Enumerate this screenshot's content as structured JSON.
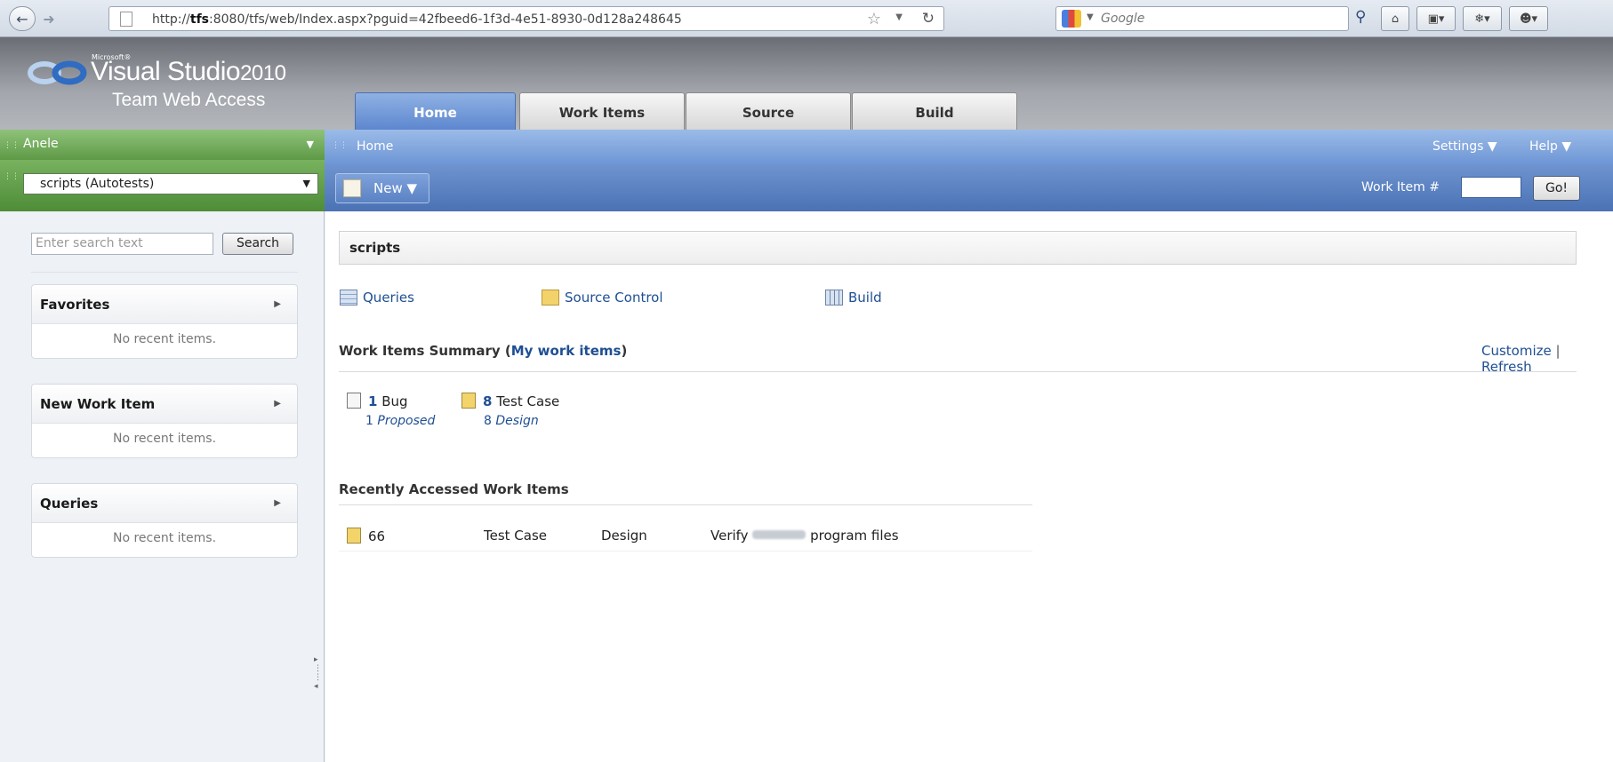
{
  "browser": {
    "url_prefix": "http://",
    "url_host": "tfs",
    "url_rest": ":8080/tfs/web/Index.aspx?pguid=42fbeed6-1f3d-4e51-8930-0d128a248645",
    "search_engine": "Google"
  },
  "logo": {
    "microsoft": "Microsoft®",
    "product": "Visual Studio",
    "year": "2010",
    "subtitle": "Team Web Access"
  },
  "tabs": [
    {
      "label": "Home"
    },
    {
      "label": "Work Items"
    },
    {
      "label": "Source"
    },
    {
      "label": "Build"
    }
  ],
  "left": {
    "user": "Anele",
    "project": "scripts (Autotests)",
    "search_placeholder": "Enter search text",
    "search_button": "Search",
    "panes": [
      {
        "title": "Favorites",
        "empty": "No recent items."
      },
      {
        "title": "New Work Item",
        "empty": "No recent items."
      },
      {
        "title": "Queries",
        "empty": "No recent items."
      }
    ]
  },
  "nav": {
    "breadcrumb": "Home",
    "settings": "Settings",
    "help": "Help",
    "new_button": "New",
    "work_item_label": "Work Item #",
    "go_button": "Go!"
  },
  "main": {
    "project_title": "scripts",
    "quick_links": [
      "Queries",
      "Source Control",
      "Build"
    ],
    "summary_title": "Work Items Summary (",
    "summary_link": "My work items",
    "summary_close": ")",
    "customize": "Customize",
    "separator": "|",
    "refresh": "Refresh",
    "summary_items": [
      {
        "count": "1",
        "type": "Bug",
        "state_count": "1",
        "state": "Proposed"
      },
      {
        "count": "8",
        "type": "Test Case",
        "state_count": "8",
        "state": "Design"
      }
    ],
    "recent_title": "Recently Accessed Work Items",
    "recent_rows": [
      {
        "id": "66",
        "type": "Test Case",
        "state": "Design",
        "title_prefix": "Verify",
        "title_suffix": "program files"
      }
    ]
  }
}
